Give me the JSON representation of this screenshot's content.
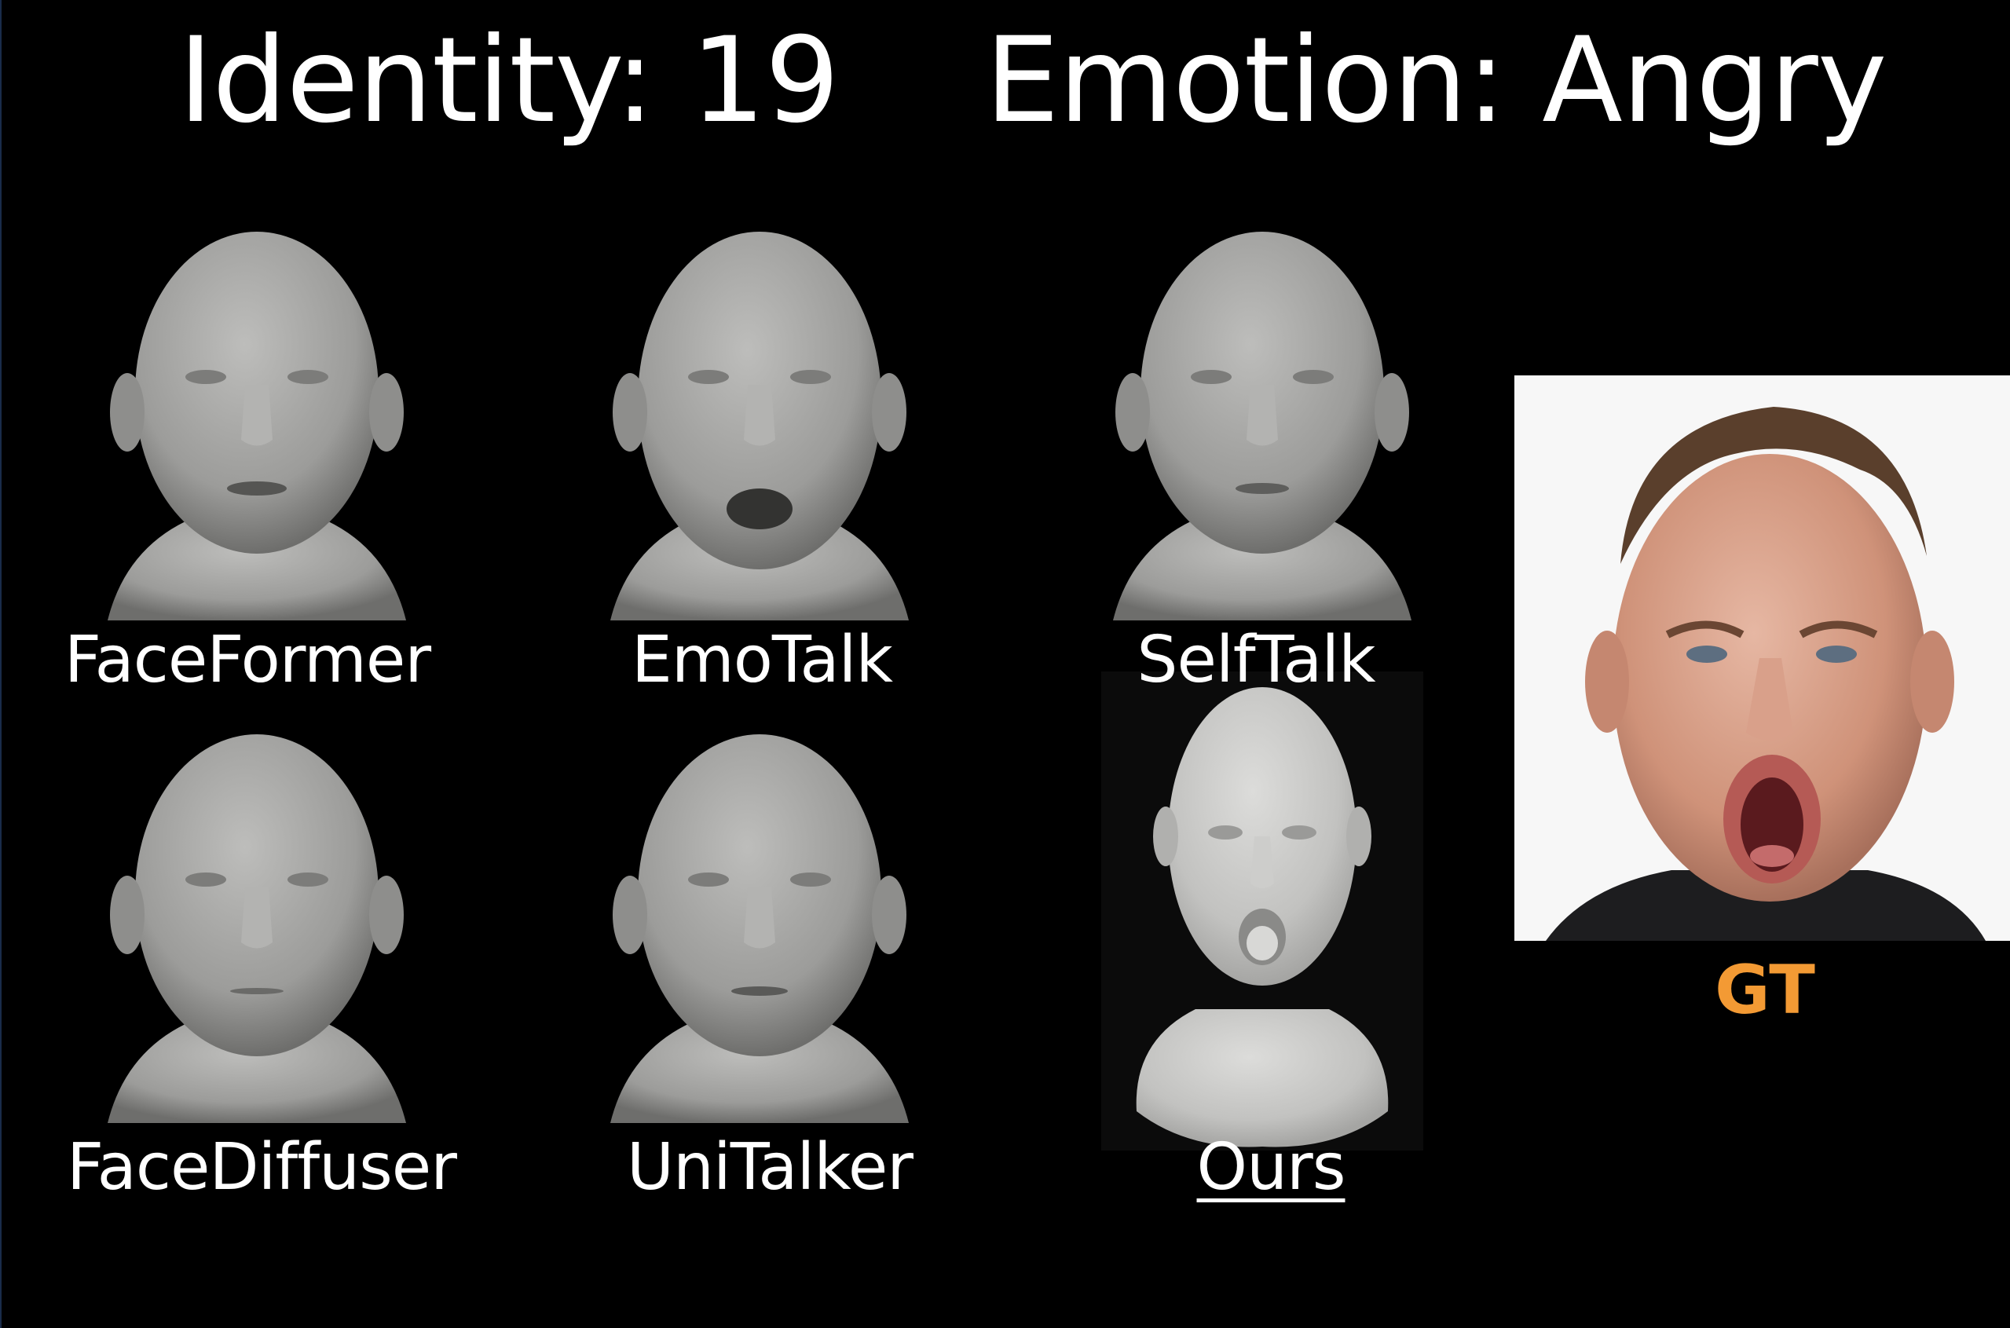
{
  "header": {
    "identity": "Identity: 19",
    "emotion": "Emotion: Angry"
  },
  "methods": [
    {
      "name": "FaceFormer"
    },
    {
      "name": "EmoTalk"
    },
    {
      "name": "SelfTalk"
    },
    {
      "name": "FaceDiffuser"
    },
    {
      "name": "UniTalker"
    },
    {
      "name": "Ours"
    }
  ],
  "ground_truth": {
    "label": "GT",
    "color": "#f39a34"
  },
  "colors": {
    "background": "#000000",
    "text": "#ffffff",
    "mesh": "#a8a8a6",
    "ours_mesh": "#c9c9c7"
  }
}
